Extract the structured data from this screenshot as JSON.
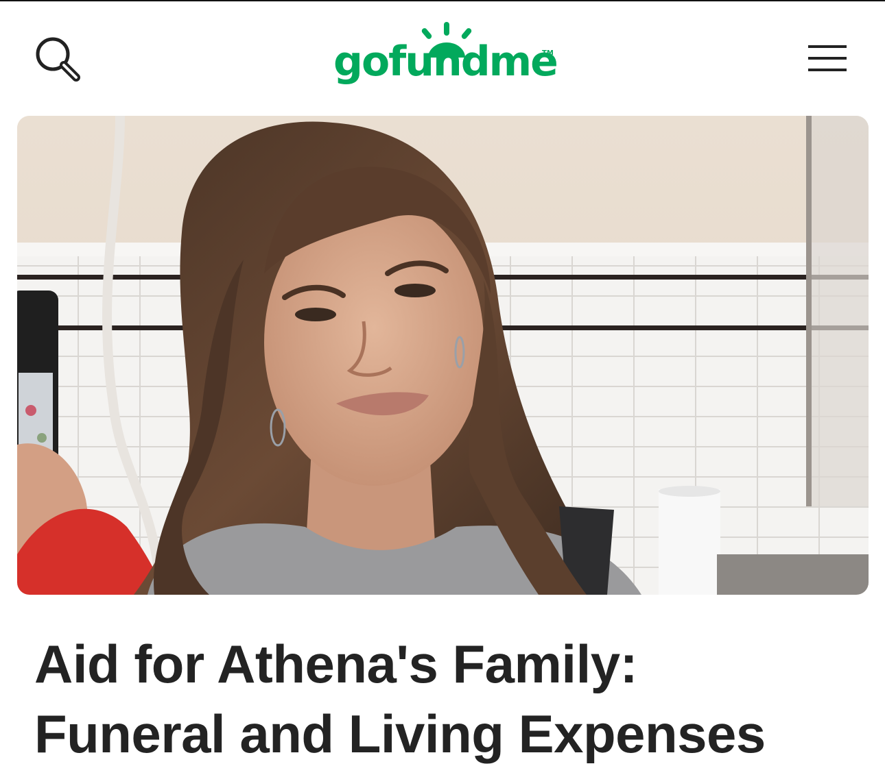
{
  "header": {
    "logo_text": "gofundme",
    "logo_tm": "TM",
    "brand_color": "#02a95c",
    "search_icon": "search-icon",
    "menu_icon": "hamburger-menu-icon"
  },
  "hero": {
    "image": "fundraiser-cover-photo"
  },
  "fundraiser": {
    "title_line1": "Aid for Athena's Family:",
    "title_line2": "Funeral and Living Expenses"
  }
}
